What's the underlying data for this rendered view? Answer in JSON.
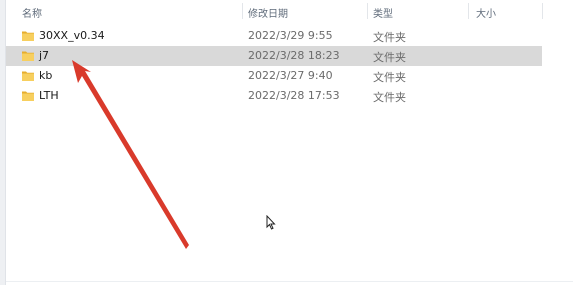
{
  "columns": {
    "name": "名称",
    "date": "修改日期",
    "type": "类型",
    "size": "大小"
  },
  "files": [
    {
      "name": "30XX_v0.34",
      "date": "2022/3/29 9:55",
      "type": "文件夹",
      "selected": false
    },
    {
      "name": "j7",
      "date": "2022/3/28 18:23",
      "type": "文件夹",
      "selected": true
    },
    {
      "name": "kb",
      "date": "2022/3/27 9:40",
      "type": "文件夹",
      "selected": false
    },
    {
      "name": "LTH",
      "date": "2022/3/28 17:53",
      "type": "文件夹",
      "selected": false
    }
  ],
  "icons": {
    "folder": "folder-icon",
    "cursor": "mouse-pointer-icon",
    "annotation": "red-arrow-annotation"
  },
  "colors": {
    "folder": "#f2c14e",
    "selected_row": "#d9d9d9",
    "annotation": "#d93a2b"
  }
}
